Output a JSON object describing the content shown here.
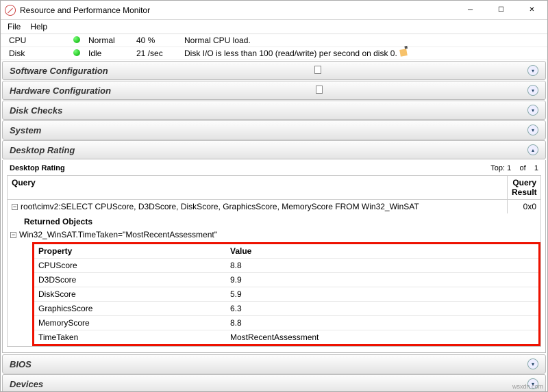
{
  "window": {
    "title": "Resource and Performance Monitor"
  },
  "menu": {
    "file": "File",
    "help": "Help"
  },
  "top": {
    "cpu": {
      "label": "CPU",
      "status": "Normal",
      "value": "40 %",
      "msg": "Normal CPU load."
    },
    "disk": {
      "label": "Disk",
      "status": "Idle",
      "value": "21 /sec",
      "msg": "Disk I/O is less than 100 (read/write) per second on disk 0."
    }
  },
  "sections": {
    "software": "Software Configuration",
    "hardware": "Hardware Configuration",
    "diskchecks": "Disk Checks",
    "system": "System",
    "desktop_rating_bar": "Desktop Rating",
    "bios": "BIOS",
    "devices": "Devices"
  },
  "rating": {
    "panel_title": "Desktop Rating",
    "top_label": "Top:",
    "top_value": "1",
    "of_label": "of",
    "of_value": "1",
    "query_col": "Query",
    "result_col": "Query Result",
    "query_text": "root\\cimv2:SELECT CPUScore, D3DScore, DiskScore, GraphicsScore, MemoryScore FROM Win32_WinSAT",
    "result_value": "0x0",
    "returned_objects": "Returned Objects",
    "object_row": "Win32_WinSAT.TimeTaken=\"MostRecentAssessment\"",
    "prop_col": "Property",
    "val_col": "Value",
    "rows": [
      {
        "k": "CPUScore",
        "v": "8.8"
      },
      {
        "k": "D3DScore",
        "v": "9.9"
      },
      {
        "k": "DiskScore",
        "v": "5.9"
      },
      {
        "k": "GraphicsScore",
        "v": "6.3"
      },
      {
        "k": "MemoryScore",
        "v": "8.8"
      },
      {
        "k": "TimeTaken",
        "v": "MostRecentAssessment"
      }
    ]
  },
  "watermark": "wsxdn.com"
}
